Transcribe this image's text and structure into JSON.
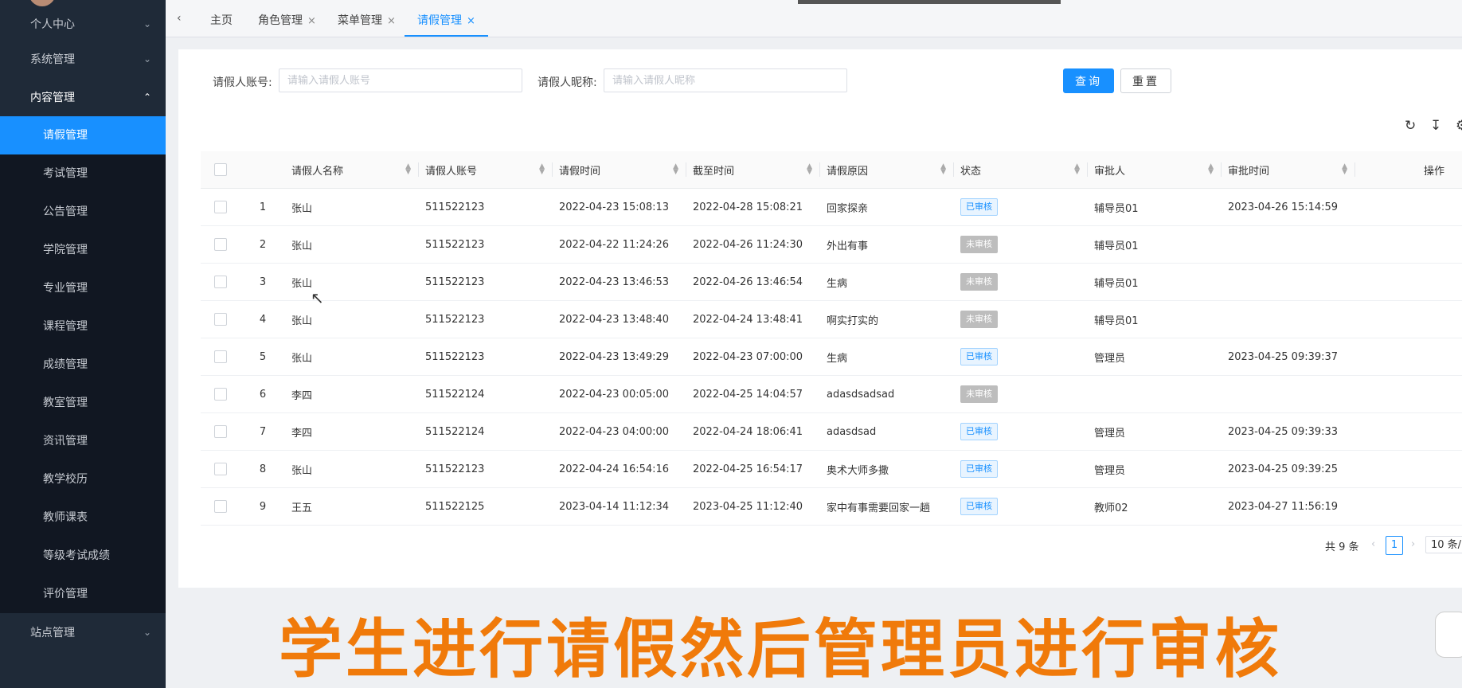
{
  "sidebar": {
    "groups": [
      {
        "label": "个人中心"
      },
      {
        "label": "系统管理"
      },
      {
        "label": "内容管理"
      },
      {
        "label": "站点管理"
      }
    ],
    "items": [
      {
        "label": "请假管理"
      },
      {
        "label": "考试管理"
      },
      {
        "label": "公告管理"
      },
      {
        "label": "学院管理"
      },
      {
        "label": "专业管理"
      },
      {
        "label": "课程管理"
      },
      {
        "label": "成绩管理"
      },
      {
        "label": "教室管理"
      },
      {
        "label": "资讯管理"
      },
      {
        "label": "教学校历"
      },
      {
        "label": "教师课表"
      },
      {
        "label": "等级考试成绩"
      },
      {
        "label": "评价管理"
      }
    ]
  },
  "tabs": [
    {
      "label": "主页"
    },
    {
      "label": "角色管理"
    },
    {
      "label": "菜单管理"
    },
    {
      "label": "请假管理"
    }
  ],
  "search": {
    "account_label": "请假人账号:",
    "account_placeholder": "请输入请假人账号",
    "nickname_label": "请假人昵称:",
    "nickname_placeholder": "请输入请假人昵称",
    "query_label": "查询",
    "reset_label": "重置"
  },
  "table": {
    "headers": [
      "请假人名称",
      "请假人账号",
      "请假时间",
      "截至时间",
      "请假原因",
      "状态",
      "审批人",
      "审批时间",
      "操作"
    ],
    "rows": [
      {
        "no": "1",
        "name": "张山",
        "account": "511522123",
        "start": "2022-04-23 15:08:13",
        "end": "2022-04-28 15:08:21",
        "reason": "回家探亲",
        "status": "已审核",
        "approver": "辅导员01",
        "approve_time": "2023-04-26 15:14:59"
      },
      {
        "no": "2",
        "name": "张山",
        "account": "511522123",
        "start": "2022-04-22 11:24:26",
        "end": "2022-04-26 11:24:30",
        "reason": "外出有事",
        "status": "未审核",
        "approver": "辅导员01",
        "approve_time": ""
      },
      {
        "no": "3",
        "name": "张山",
        "account": "511522123",
        "start": "2022-04-23 13:46:53",
        "end": "2022-04-26 13:46:54",
        "reason": "生病",
        "status": "未审核",
        "approver": "辅导员01",
        "approve_time": ""
      },
      {
        "no": "4",
        "name": "张山",
        "account": "511522123",
        "start": "2022-04-23 13:48:40",
        "end": "2022-04-24 13:48:41",
        "reason": "啊实打实的",
        "status": "未审核",
        "approver": "辅导员01",
        "approve_time": ""
      },
      {
        "no": "5",
        "name": "张山",
        "account": "511522123",
        "start": "2022-04-23 13:49:29",
        "end": "2022-04-23 07:00:00",
        "reason": "生病",
        "status": "已审核",
        "approver": "管理员",
        "approve_time": "2023-04-25 09:39:37"
      },
      {
        "no": "6",
        "name": "李四",
        "account": "511522124",
        "start": "2022-04-23 00:05:00",
        "end": "2022-04-25 14:04:57",
        "reason": "adasdsadsad",
        "status": "未审核",
        "approver": "",
        "approve_time": ""
      },
      {
        "no": "7",
        "name": "李四",
        "account": "511522124",
        "start": "2022-04-23 04:00:00",
        "end": "2022-04-24 18:06:41",
        "reason": "adasdsad",
        "status": "已审核",
        "approver": "管理员",
        "approve_time": "2023-04-25 09:39:33"
      },
      {
        "no": "8",
        "name": "张山",
        "account": "511522123",
        "start": "2022-04-24 16:54:16",
        "end": "2022-04-25 16:54:17",
        "reason": "奥术大师多撒",
        "status": "已审核",
        "approver": "管理员",
        "approve_time": "2023-04-25 09:39:25"
      },
      {
        "no": "9",
        "name": "王五",
        "account": "511522125",
        "start": "2023-04-14 11:12:34",
        "end": "2023-04-25 11:12:40",
        "reason": "家中有事需要回家一趟",
        "status": "已审核",
        "approver": "教师02",
        "approve_time": "2023-04-27 11:56:19"
      }
    ]
  },
  "pagination": {
    "total": "共 9 条",
    "current": "1",
    "page_size": "10 条/"
  },
  "caption": "学生进行请假然后管理员进行审核",
  "colors": {
    "accent": "#1890ff",
    "sidebar_bg": "#1f2a38",
    "caption": "#f07a0a"
  }
}
